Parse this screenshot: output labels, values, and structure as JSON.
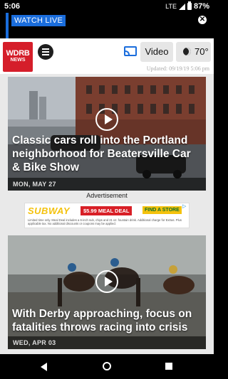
{
  "status_bar": {
    "time": "5:06",
    "network": "LTE",
    "battery": "87%"
  },
  "live_banner": {
    "label": "WATCH LIVE",
    "close_icon": "close-icon"
  },
  "header": {
    "logo_line1": "WDRB",
    "logo_line2": "NEWS",
    "video_label": "Video",
    "temperature": "70°",
    "updated": "Updated: 09/19/19 5:06 pm"
  },
  "stories": [
    {
      "headline": "Classic cars roll into the Portland neighborhood for Beatersville Car & Bike Show",
      "date": "MON, MAY 27"
    },
    {
      "headline": "With Derby approaching, focus on fatalities throws racing into crisis",
      "date": "WED, APR 03"
    }
  ],
  "ad": {
    "label": "Advertisement",
    "brand": "SUBWAY",
    "deal": "$5.99 MEAL DEAL",
    "cta": "FIND A STORE",
    "fine_print": "Limited time only. Meal Deal includes a 6-inch sub, chips and 21 oz. fountain drink. Additional charge for Extras. Plus applicable tax. No additional discounts or coupons may be applied."
  },
  "colors": {
    "accent": "#1a6ddc",
    "logo_red": "#d51e2a"
  }
}
